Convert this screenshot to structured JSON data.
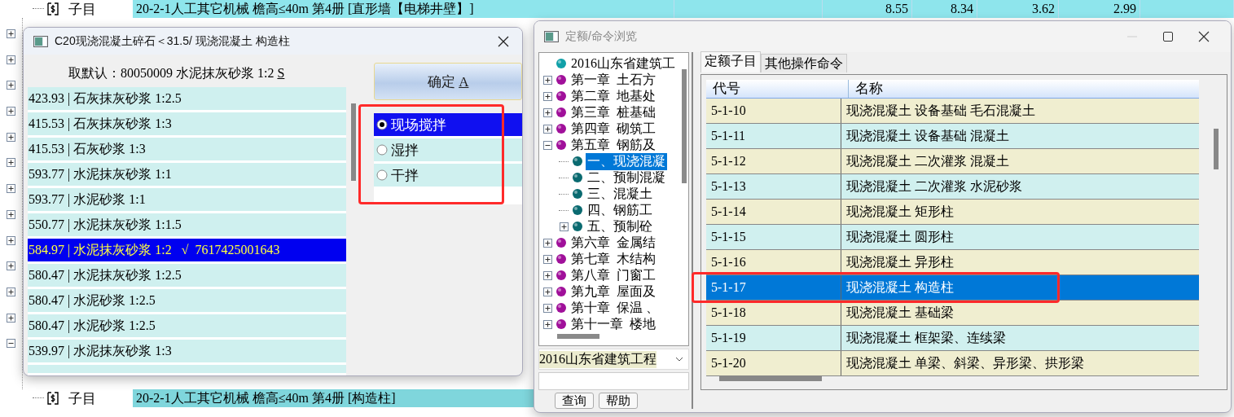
{
  "background": {
    "top_row": {
      "label": "子目",
      "description": "20-2-1人工其它机械 檐高≤40m 第4册 [直形墙【电梯井壁】]",
      "values": [
        "8.55",
        "8.34",
        "3.62",
        "2.99"
      ]
    },
    "row_toggles": [
      {
        "expanded": false
      },
      {
        "expanded": false
      },
      {
        "expanded": false
      },
      {
        "expanded": false
      },
      {
        "expanded": false
      },
      {
        "expanded": false
      },
      {
        "expanded": false
      },
      {
        "expanded": false
      },
      {
        "expanded": false
      },
      {
        "expanded": false
      },
      {
        "expanded": false
      },
      {
        "expanded": false
      },
      {
        "expanded": true
      }
    ],
    "bottom_row": {
      "label": "子目",
      "description": "20-2-1人工其它机械 檐高≤40m 第4册 [构造柱]"
    }
  },
  "mix_dialog": {
    "title": "C20现浇混凝土碎石＜31.5/ 现浇混凝土 构造柱",
    "default_label": "取默认：80050009 水泥抹灰砂浆 1:2 ",
    "default_key": "S",
    "ok_button": {
      "label": "确定 ",
      "key": "A"
    },
    "items": [
      {
        "text": "423.93 | 石灰抹灰砂浆 1:2.5",
        "selected": false
      },
      {
        "text": "415.53 | 石灰抹灰砂浆 1:3",
        "selected": false
      },
      {
        "text": "415.53 | 石灰砂浆 1:3",
        "selected": false
      },
      {
        "text": "593.77 | 水泥抹灰砂浆 1:1",
        "selected": false
      },
      {
        "text": "593.77 | 水泥砂浆 1:1",
        "selected": false
      },
      {
        "text": "550.77 | 水泥抹灰砂浆 1:1.5",
        "selected": false
      },
      {
        "text": "584.97 | 水泥抹灰砂浆 1:2   √  7617425001643",
        "selected": true
      },
      {
        "text": "580.47 | 水泥抹灰砂浆 1:2.5",
        "selected": false
      },
      {
        "text": "580.47 | 水泥砂浆 1:2.5",
        "selected": false
      },
      {
        "text": "580.47 | 水泥砂浆 1:2.5",
        "selected": false
      },
      {
        "text": "539.97 | 水泥抹灰砂浆 1:3",
        "selected": false
      }
    ],
    "mix_options": [
      {
        "label": "现场搅拌",
        "selected": true
      },
      {
        "label": "湿拌",
        "selected": false
      },
      {
        "label": "干拌",
        "selected": false
      }
    ]
  },
  "browser_dialog": {
    "title": "定额/命令浏览",
    "tree": [
      {
        "label": "2016山东省建筑工",
        "color": "#10a0a8",
        "kind": "leaf",
        "selected": false
      },
      {
        "label": "第一章  土石方",
        "color": "#a0109a",
        "kind": "branch",
        "expanded": false,
        "selected": false
      },
      {
        "label": "第二章  地基处",
        "color": "#a0109a",
        "kind": "branch",
        "expanded": false,
        "selected": false
      },
      {
        "label": "第三章  桩基础",
        "color": "#a0109a",
        "kind": "branch",
        "expanded": false,
        "selected": false
      },
      {
        "label": "第四章  砌筑工",
        "color": "#a0109a",
        "kind": "branch",
        "expanded": false,
        "selected": false
      },
      {
        "label": "第五章  钢筋及",
        "color": "#a0109a",
        "kind": "branch",
        "expanded": true,
        "selected": false,
        "children": [
          {
            "label": "一、现浇混凝",
            "color": "#0a6a70",
            "kind": "leaf",
            "selected": true
          },
          {
            "label": "二、预制混凝",
            "color": "#0a6a70",
            "kind": "leaf",
            "selected": false
          },
          {
            "label": "三、混凝土",
            "color": "#0a6a70",
            "kind": "leaf",
            "selected": false
          },
          {
            "label": "四、钢筋工",
            "color": "#0a6a70",
            "kind": "leaf",
            "selected": false
          },
          {
            "label": "五、预制砼",
            "color": "#0a6a70",
            "kind": "branch",
            "expanded": false,
            "selected": false
          }
        ]
      },
      {
        "label": "第六章  金属结",
        "color": "#a0109a",
        "kind": "branch",
        "expanded": false,
        "selected": false
      },
      {
        "label": "第七章  木结构",
        "color": "#a0109a",
        "kind": "branch",
        "expanded": false,
        "selected": false
      },
      {
        "label": "第八章  门窗工",
        "color": "#a0109a",
        "kind": "branch",
        "expanded": false,
        "selected": false
      },
      {
        "label": "第九章  屋面及",
        "color": "#a0109a",
        "kind": "branch",
        "expanded": false,
        "selected": false
      },
      {
        "label": "第十章  保温 、",
        "color": "#a0109a",
        "kind": "branch",
        "expanded": false,
        "selected": false
      },
      {
        "label": "第十一章  楼地",
        "color": "#a0109a",
        "kind": "branch",
        "expanded": false,
        "selected": false
      }
    ],
    "library_select": "2016山东省建筑工程",
    "buttons": [
      "查询",
      "帮助"
    ],
    "tabs": [
      {
        "label": "定额子目",
        "selected": true
      },
      {
        "label": "其他操作命令",
        "selected": false
      }
    ],
    "table": {
      "columns": [
        "代号",
        "名称"
      ],
      "rows": [
        {
          "code": "5-1-10",
          "name": "现浇混凝土 设备基础 毛石混凝土",
          "selected": false
        },
        {
          "code": "5-1-11",
          "name": "现浇混凝土 设备基础 混凝土",
          "selected": false
        },
        {
          "code": "5-1-12",
          "name": "现浇混凝土 二次灌浆 混凝土",
          "selected": false
        },
        {
          "code": "5-1-13",
          "name": "现浇混凝土 二次灌浆 水泥砂浆",
          "selected": false
        },
        {
          "code": "5-1-14",
          "name": "现浇混凝土 矩形柱",
          "selected": false
        },
        {
          "code": "5-1-15",
          "name": "现浇混凝土 圆形柱",
          "selected": false
        },
        {
          "code": "5-1-16",
          "name": "现浇混凝土 异形柱",
          "selected": false
        },
        {
          "code": "5-1-17",
          "name": "现浇混凝土 构造柱",
          "selected": true
        },
        {
          "code": "5-1-18",
          "name": "现浇混凝土 基础梁",
          "selected": false
        },
        {
          "code": "5-1-19",
          "name": "现浇混凝土 框架梁、连续梁",
          "selected": false
        },
        {
          "code": "5-1-20",
          "name": "现浇混凝土 单梁、斜梁、异形梁、拱形梁",
          "selected": false
        }
      ]
    }
  }
}
